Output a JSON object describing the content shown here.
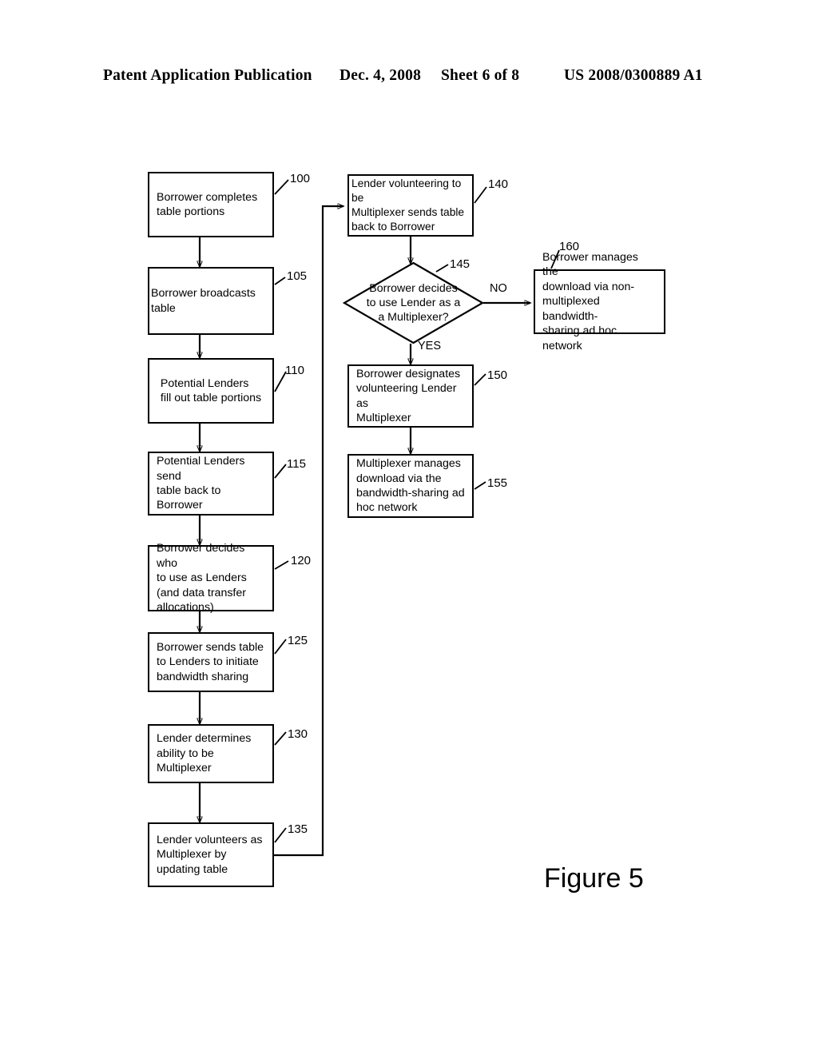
{
  "header": {
    "publication": "Patent Application Publication",
    "date": "Dec. 4, 2008",
    "sheet": "Sheet 6 of 8",
    "patent_number": "US 2008/0300889 A1"
  },
  "figure": {
    "caption": "Figure 5",
    "type": "flowchart"
  },
  "nodes": [
    {
      "ref": "100",
      "shape": "process",
      "text": "Borrower completes\ntable portions"
    },
    {
      "ref": "105",
      "shape": "process",
      "text": "Borrower broadcasts table"
    },
    {
      "ref": "110",
      "shape": "process",
      "text": "Potential Lenders\nfill out table portions"
    },
    {
      "ref": "115",
      "shape": "process",
      "text": "Potential Lenders send\ntable back to Borrower"
    },
    {
      "ref": "120",
      "shape": "process",
      "text": "Borrower decides who\nto use as Lenders\n(and data transfer\nallocations)"
    },
    {
      "ref": "125",
      "shape": "process",
      "text": "Borrower sends table\nto Lenders to initiate\nbandwidth sharing"
    },
    {
      "ref": "130",
      "shape": "process",
      "text": "Lender determines\nability to be\nMultiplexer"
    },
    {
      "ref": "135",
      "shape": "process",
      "text": "Lender volunteers as\nMultiplexer by\nupdating table"
    },
    {
      "ref": "140",
      "shape": "process",
      "text": "Lender volunteering to be\nMultiplexer sends table\nback to Borrower"
    },
    {
      "ref": "145",
      "shape": "decision",
      "text": "Borrower decides\nto use Lender as a\na Multiplexer?"
    },
    {
      "ref": "150",
      "shape": "process",
      "text": "Borrower designates\nvolunteering Lender as\nMultiplexer"
    },
    {
      "ref": "155",
      "shape": "process",
      "text": "Multiplexer manages\ndownload via  the\nbandwidth-sharing ad\nhoc network"
    },
    {
      "ref": "160",
      "shape": "process",
      "text": "Borrower manages the\ndownload via non-\nmultiplexed bandwidth-\nsharing ad hoc network"
    }
  ],
  "branch_labels": {
    "no": "NO",
    "yes": "YES"
  }
}
